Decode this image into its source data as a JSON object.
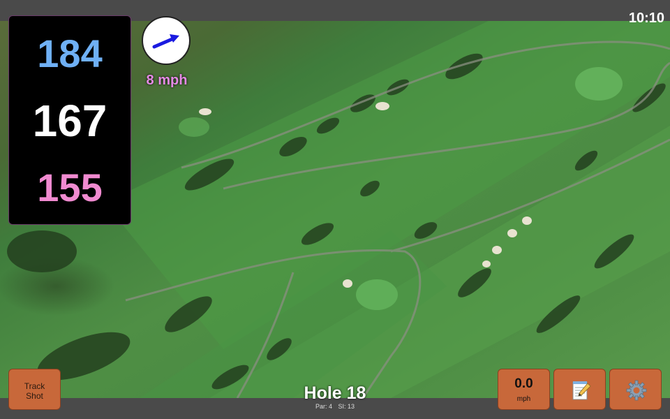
{
  "status": {
    "clock": "10:10"
  },
  "yardages": {
    "back": "184",
    "middle": "167",
    "front": "155",
    "colors": {
      "back": "#6fb0f5",
      "middle": "#ffffff",
      "front": "#f08ad0"
    }
  },
  "wind": {
    "speed": "8 mph",
    "arrow_color": "#1a1ae0"
  },
  "buttons": {
    "track_shot": {
      "line1": "Track",
      "line2": "Shot"
    },
    "speed": {
      "value": "0.0",
      "unit": "mph"
    },
    "scorecard_icon": "notepad-icon",
    "settings_icon": "gear-icon"
  },
  "hole": {
    "title": "Hole 18",
    "par": "Par: 4",
    "si": "SI: 13"
  }
}
